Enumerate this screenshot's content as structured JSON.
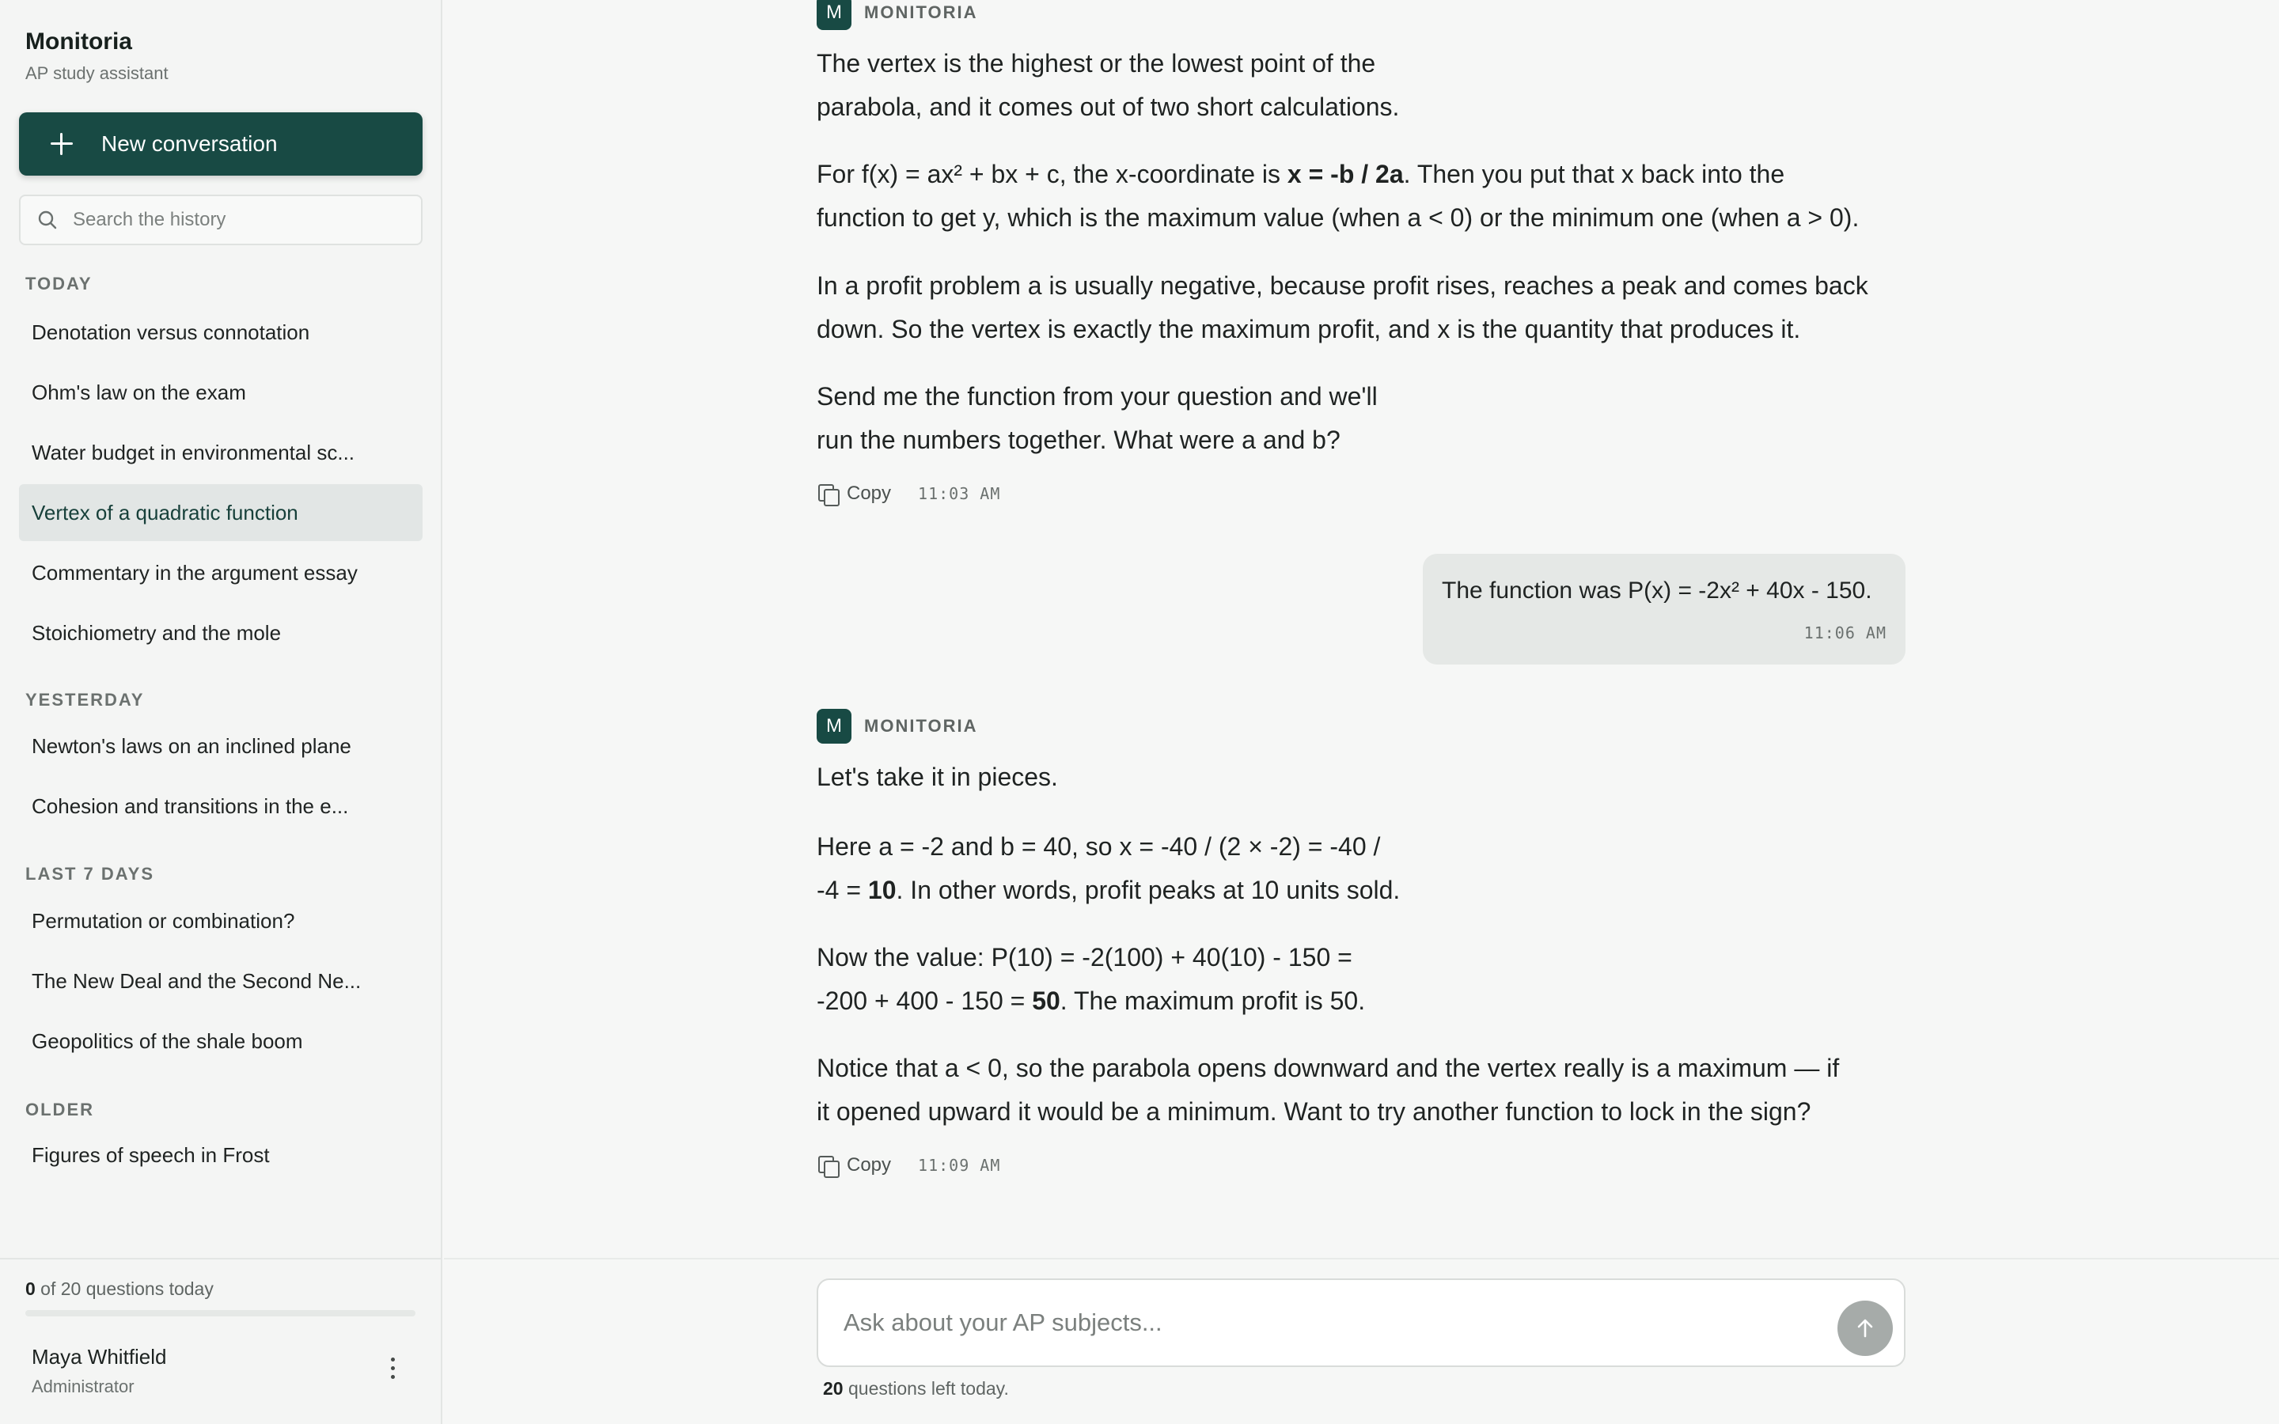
{
  "brand": {
    "name": "Monitoria",
    "subtitle": "AP study assistant"
  },
  "new_conversation_label": "New conversation",
  "search": {
    "placeholder": "Search the history"
  },
  "history": {
    "today_label": "TODAY",
    "today": [
      "Denotation versus connotation",
      "Ohm's law on the exam",
      "Water budget in environmental sc...",
      "Vertex of a quadratic function",
      "Commentary in the argument essay",
      "Stoichiometry and the mole"
    ],
    "yesterday_label": "YESTERDAY",
    "yesterday": [
      "Newton's laws on an inclined plane",
      "Cohesion and transitions in the e..."
    ],
    "last7_label": "LAST 7 DAYS",
    "last7": [
      "Permutation or combination?",
      "The New Deal and the Second Ne...",
      "Geopolitics of the shale boom"
    ],
    "older_label": "OLDER",
    "older": [
      "Figures of speech in Frost"
    ],
    "active_item": "Vertex of a quadratic function"
  },
  "quota": {
    "used": "0",
    "text": " of 20 questions today",
    "fraction": 0
  },
  "user": {
    "name": "Maya Whitfield",
    "role": "Administrator"
  },
  "assistant": {
    "name": "MONITORIA",
    "initial": "M"
  },
  "messages": {
    "first": {
      "p1a": "The vertex is the highest or the lowest point of the",
      "p1b": "parabola, and it comes out of two short calculations.",
      "p2a_pre": "For f(x) = ax² + bx + c, the x-coordinate is ",
      "p2a_bold": "x = -b / 2a",
      "p2a_post": ". Then you put that x back into the",
      "p2b": "function to get y, which is the maximum value (when a < 0) or the minimum one (when a > 0).",
      "p3a": "In a profit problem a is usually negative, because profit rises, reaches a peak and comes back",
      "p3b": "down. So the vertex is exactly the maximum profit, and x is the quantity that produces it.",
      "p4a": "Send me the function from your question and we'll",
      "p4b": "run the numbers together. What were a and b?",
      "time": "11:03 AM"
    },
    "user": {
      "text": "The function was P(x) = -2x² + 40x - 150.",
      "time": "11:06 AM"
    },
    "second": {
      "p1": "Let's take it in pieces.",
      "p2a": "Here a = -2 and b = 40, so x = -40 / (2 × -2) = -40 /",
      "p2b_pre": "-4 = ",
      "p2b_bold": "10",
      "p2b_post": ". In other words, profit peaks at 10 units sold.",
      "p3a": "Now the value: P(10) = -2(100) + 40(10) - 150 =",
      "p3b_pre": "-200 + 400 - 150 = ",
      "p3b_bold": "50",
      "p3b_post": ". The maximum profit is 50.",
      "p4a": "Notice that a < 0, so the parabola opens downward and the vertex really is a maximum — if",
      "p4b": "it opened upward it would be a minimum. Want to try another function to lock in the sign?",
      "time": "11:09 AM"
    },
    "copy_label": "Copy"
  },
  "composer": {
    "placeholder": "Ask about your AP subjects...",
    "remaining_count": "20",
    "remaining_text": " questions left today."
  },
  "icons": {
    "new": "plus-icon",
    "search": "search-icon",
    "copy": "copy-icon",
    "send": "arrow-up-icon",
    "menu": "kebab-menu-icon"
  },
  "colors": {
    "accent": "#184a44",
    "active_bg": "#e2e6e5",
    "bubble_bg": "#e5e8e6",
    "send_disabled": "#a6aba9"
  }
}
